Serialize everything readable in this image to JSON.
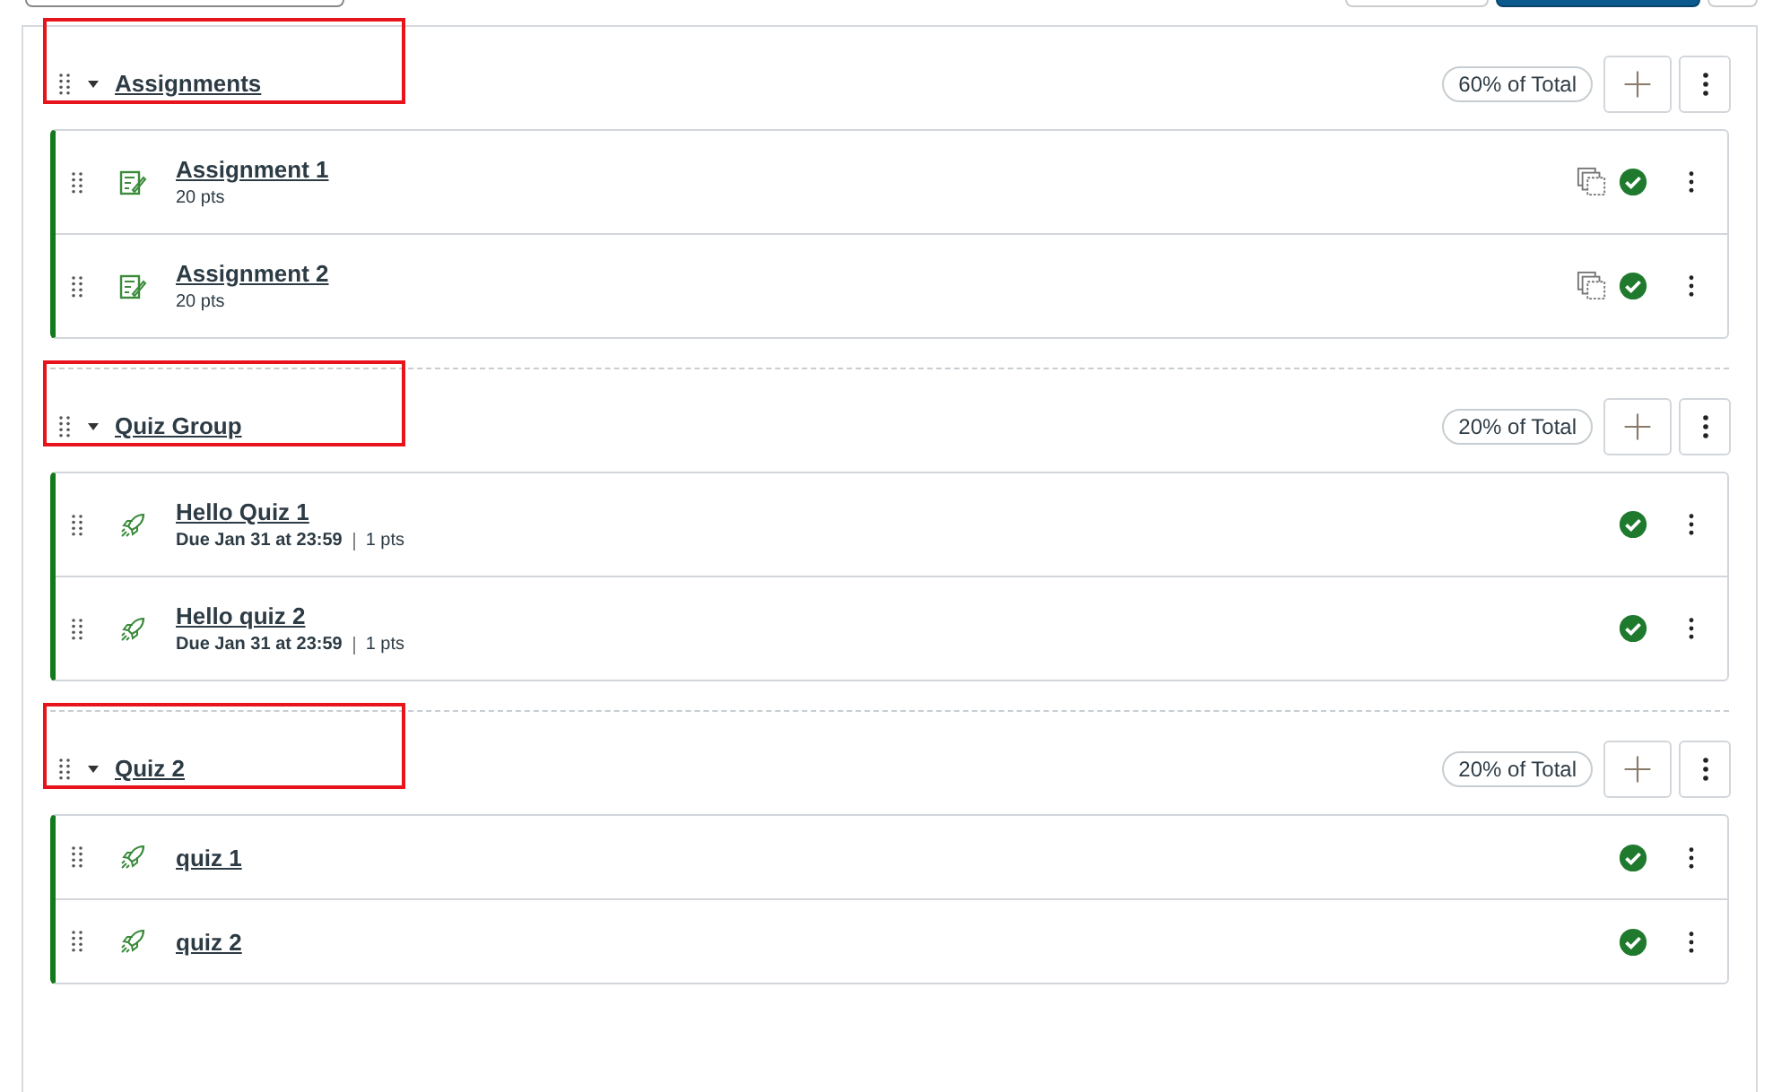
{
  "groups": [
    {
      "title": "Assignments",
      "expanded": true,
      "highlighted": true,
      "weight": "60% of Total",
      "items": [
        {
          "kind": "assignment",
          "title": "Assignment 1",
          "points": "20 pts",
          "copy": true,
          "published": true
        },
        {
          "kind": "assignment",
          "title": "Assignment 2",
          "points": "20 pts",
          "copy": true,
          "published": true
        }
      ]
    },
    {
      "title": "Quiz Group",
      "expanded": true,
      "highlighted": true,
      "weight": "20% of Total",
      "items": [
        {
          "kind": "quiz",
          "title": "Hello Quiz 1",
          "due": "Due Jan 31 at 23:59",
          "points": "1 pts",
          "copy": false,
          "published": true
        },
        {
          "kind": "quiz",
          "title": "Hello quiz 2",
          "due": "Due Jan 31 at 23:59",
          "points": "1 pts",
          "copy": false,
          "published": true
        }
      ]
    },
    {
      "title": "Quiz 2",
      "expanded": true,
      "highlighted": true,
      "weight": "20% of Total",
      "items": [
        {
          "kind": "quiz",
          "title": "quiz 1",
          "copy": false,
          "published": true
        },
        {
          "kind": "quiz",
          "title": "quiz 2",
          "copy": false,
          "published": true
        }
      ]
    }
  ]
}
